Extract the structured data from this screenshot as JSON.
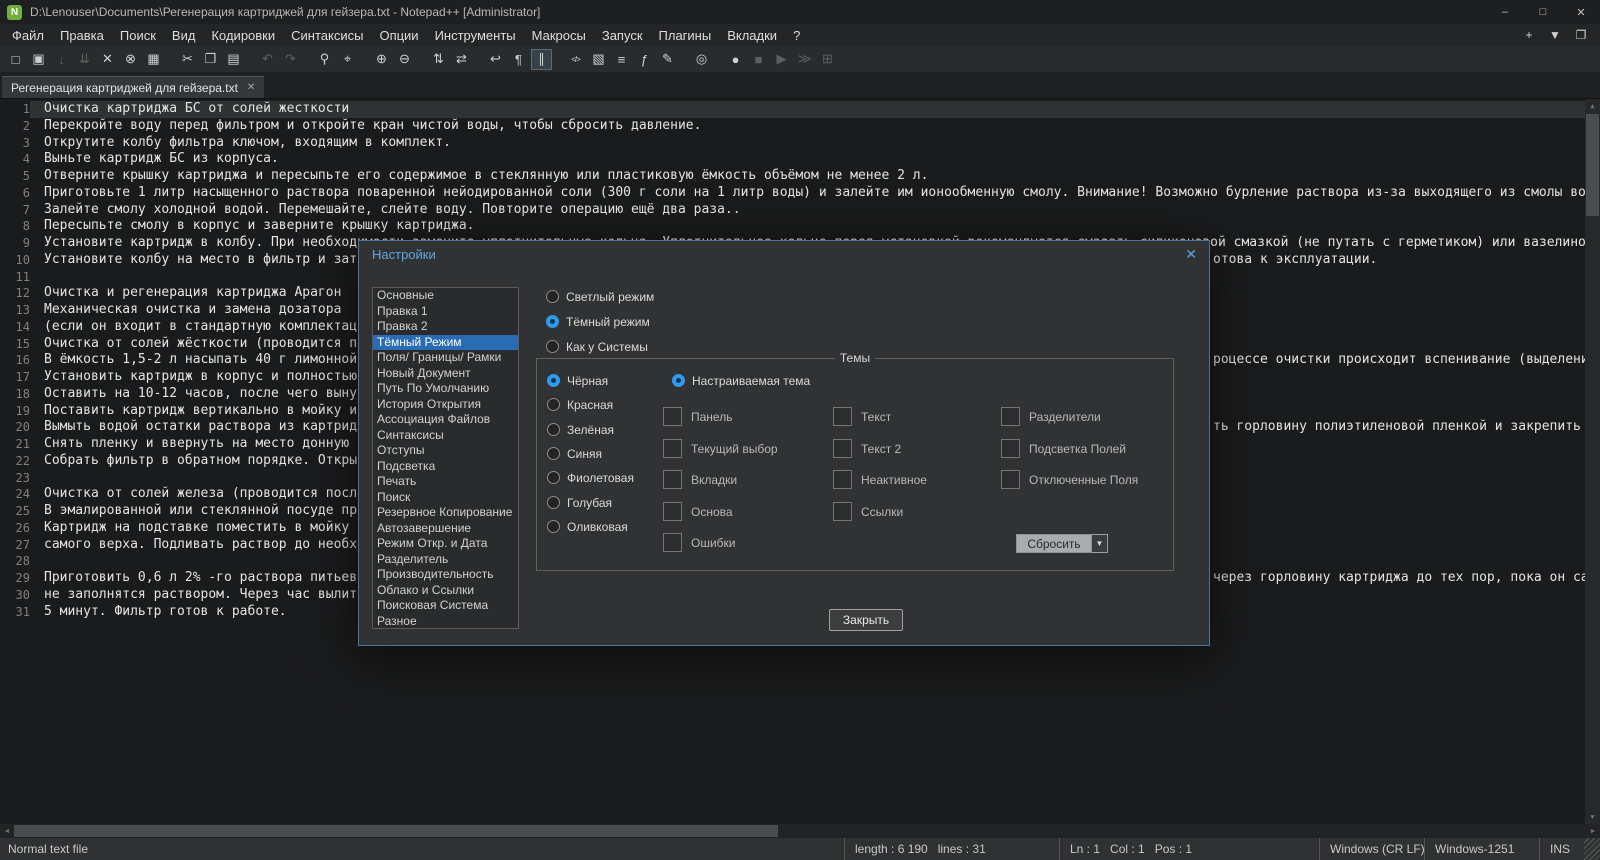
{
  "colors": {
    "accent_blue": "#2f9bed",
    "selected_item_bg": "#2a6cb4",
    "dialog_border": "#49759c",
    "current_line_bg": "#2f3334",
    "editor_bg": "#1a1b1c"
  },
  "window": {
    "title": "D:\\Lenouser\\Documents\\Регенерация картриджей для гейзера.txt - Notepad++ [Administrator]",
    "app_icon_letter": "N",
    "controls": [
      {
        "name": "minimize-button",
        "glyph": "–"
      },
      {
        "name": "maximize-button",
        "glyph": "□"
      },
      {
        "name": "close-button",
        "glyph": "✕"
      }
    ]
  },
  "menubar": {
    "items": [
      "Файл",
      "Правка",
      "Поиск",
      "Вид",
      "Кодировки",
      "Синтаксисы",
      "Опции",
      "Инструменты",
      "Макросы",
      "Запуск",
      "Плагины",
      "Вкладки",
      "?"
    ],
    "right_buttons": [
      {
        "name": "new-tab-button",
        "glyph": "+"
      },
      {
        "name": "tab-list-button",
        "glyph": "▼"
      },
      {
        "name": "windows-button",
        "glyph": "❐"
      }
    ]
  },
  "toolbar": {
    "icons": [
      {
        "name": "new-file-icon",
        "glyph": "□"
      },
      {
        "name": "open-folder-icon",
        "glyph": "▣"
      },
      {
        "name": "save-icon",
        "glyph": "↓",
        "disabled": true
      },
      {
        "name": "save-all-icon",
        "glyph": "⇊",
        "disabled": true
      },
      {
        "name": "close-file-icon",
        "glyph": "✕"
      },
      {
        "name": "close-all-icon",
        "glyph": "⊗"
      },
      {
        "name": "print-icon",
        "glyph": "▦"
      },
      {
        "name": "cut-icon",
        "glyph": "✂",
        "gap": true
      },
      {
        "name": "copy-icon",
        "glyph": "❐"
      },
      {
        "name": "paste-icon",
        "glyph": "▤"
      },
      {
        "name": "undo-icon",
        "glyph": "↶",
        "gap": true,
        "disabled": true
      },
      {
        "name": "redo-icon",
        "glyph": "↷",
        "disabled": true
      },
      {
        "name": "find-icon",
        "glyph": "⚲",
        "gap": true
      },
      {
        "name": "replace-icon",
        "glyph": "⌖"
      },
      {
        "name": "zoom-in-icon",
        "glyph": "⊕",
        "gap": true
      },
      {
        "name": "zoom-out-icon",
        "glyph": "⊖"
      },
      {
        "name": "sync-vertical-icon",
        "glyph": "⇅",
        "gap": true
      },
      {
        "name": "sync-horizontal-icon",
        "glyph": "⇄"
      },
      {
        "name": "word-wrap-icon",
        "glyph": "↩",
        "gap": true
      },
      {
        "name": "show-all-chars-icon",
        "glyph": "¶"
      },
      {
        "name": "indent-guide-icon",
        "glyph": "∥",
        "active": true
      },
      {
        "name": "code-view-icon",
        "glyph": "</>",
        "gap": true,
        "small": true
      },
      {
        "name": "document-map-icon",
        "glyph": "▧"
      },
      {
        "name": "document-list-icon",
        "glyph": "≡"
      },
      {
        "name": "function-list-icon",
        "glyph": "ƒ"
      },
      {
        "name": "edit-popup-icon",
        "glyph": "✎"
      },
      {
        "name": "monitoring-eye-icon",
        "glyph": "◎",
        "gap": true
      },
      {
        "name": "record-macro-icon",
        "glyph": "●",
        "gap": true
      },
      {
        "name": "stop-macro-icon",
        "glyph": "■",
        "disabled": true
      },
      {
        "name": "play-macro-icon",
        "glyph": "▶",
        "disabled": true
      },
      {
        "name": "run-macro-multiple-icon",
        "glyph": "≫",
        "disabled": true
      },
      {
        "name": "save-macro-icon",
        "glyph": "⊞",
        "disabled": true
      }
    ]
  },
  "tabbar": {
    "tabs": [
      {
        "label": "Регенерация картриджей для гейзера.txt",
        "close_glyph": "✕",
        "active": true
      }
    ]
  },
  "scrollbar": {
    "up": "▲",
    "down": "▼",
    "left": "◄",
    "right": "►"
  },
  "editor": {
    "lines": [
      {
        "n": 1,
        "current": true,
        "text": "Очистка картриджа БС от солей жесткости"
      },
      {
        "n": 2,
        "text": "Перекройте воду перед фильтром и откройте кран чистой воды, чтобы сбросить давление."
      },
      {
        "n": 3,
        "text": "Открутите колбу фильтра ключом, входящим в комплект."
      },
      {
        "n": 4,
        "text": "Выньте картридж БС из корпуса."
      },
      {
        "n": 5,
        "text": "Отверните крышку картриджа и пересыпьте его содержимое в стеклянную или пластиковую ёмкость объёмом не менее 2 л."
      },
      {
        "n": 6,
        "text": "Приготовьте 1 литр насыщенного раствора поваренной нейодированной соли (300 г соли на 1 литр воды) и залейте им ионообменную смолу. Внимание! Возможно бурление раствора из-за выходящего из смолы воздуха. Переме"
      },
      {
        "n": 7,
        "text": "Залейте смолу холодной водой. Перемешайте, слейте воду. Повторите операцию ещё два раза.."
      },
      {
        "n": 8,
        "text": "Пересыпьте смолу в корпус и заверните крышку картриджа."
      },
      {
        "n": 9,
        "text": "Установите картридж в колбу. При необходимости замените уплотнительные кольца. Уплотнительное кольцо перед установкой рекомендуется смазать силиконовой смазкой (не путать с герметиком) или вазелином."
      },
      {
        "n": 10,
        "text": "Установите колбу на место в фильтр и затян",
        "right": "отова к эксплуатации."
      },
      {
        "n": 11,
        "text": ""
      },
      {
        "n": 12,
        "text": "Очистка и регенерация картриджа Арагон"
      },
      {
        "n": 13,
        "text": "Механическая очистка и замена дозатора"
      },
      {
        "n": 14,
        "text": "(если он входит в стандартную комплектаци"
      },
      {
        "n": 15,
        "text": "Очистка от солей жёсткости (проводится пос"
      },
      {
        "n": 16,
        "text": "В ёмкость 1,5-2 л насыпать 40 г лимонной к",
        "right": "роцессе очистки происходит вспенивание (выделение"
      },
      {
        "n": 17,
        "text": "Установить картридж в корпус и полностью з"
      },
      {
        "n": 18,
        "text": "Оставить на 10-12 часов, после чего вынут"
      },
      {
        "n": 19,
        "text": "Поставить картридж вертикально в мойку и п"
      },
      {
        "n": 20,
        "text": "Вымыть водой остатки раствора из картриджа",
        "right": "ть горловину полиэтиленовой пленкой и закрепить ее"
      },
      {
        "n": 21,
        "text": "Снять пленку и ввернуть на место донную за"
      },
      {
        "n": 22,
        "text": "Собрать фильтр в обратном порядке. Откры"
      },
      {
        "n": 23,
        "text": ""
      },
      {
        "n": 24,
        "text": "Очистка от солей железа (проводится после"
      },
      {
        "n": 25,
        "text": "В эмалированной или стеклянной посуде приг"
      },
      {
        "n": 26,
        "text": "Картридж на подставке поместить в мойку и"
      },
      {
        "n": 27,
        "text": "самого верха. Подливать раствор до необх"
      },
      {
        "n": 28,
        "text": ""
      },
      {
        "n": 29,
        "text": "Приготовить 0,6 л 2% -го раствора питьевой",
        "right": "через горловину картриджа до тех пор, пока он са"
      },
      {
        "n": 30,
        "text": "не заполнятся раствором. Через час вылить"
      },
      {
        "n": 31,
        "text": "5 минут. Фильтр готов к работе."
      }
    ]
  },
  "dialog": {
    "title": "Настройки",
    "close_glyph": "✕",
    "categories": [
      "Основные",
      "Правка 1",
      "Правка 2",
      "Тёмный Режим",
      "Поля/ Границы/ Рамки",
      "Новый Документ",
      "Путь По Умолчанию",
      "История Открытия",
      "Ассоциация Файлов",
      "Синтаксисы",
      "Отступы",
      "Подсветка",
      "Печать",
      "Поиск",
      "Резервное Копирование",
      "Автозавершение",
      "Режим Откр. и Дата",
      "Разделитель",
      "Производительность",
      "Облако и Ссылки",
      "Поисковая Система",
      "Разное"
    ],
    "selected_category": "Тёмный Режим",
    "mode_options": [
      {
        "label": "Светлый режим",
        "selected": false
      },
      {
        "label": "Тёмный режим",
        "selected": true
      },
      {
        "label": "Как у Системы",
        "selected": false
      }
    ],
    "themes_group": {
      "title": "Темы",
      "tones": [
        {
          "label": "Чёрная",
          "selected": true
        },
        {
          "label": "Красная",
          "selected": false
        },
        {
          "label": "Зелёная",
          "selected": false
        },
        {
          "label": "Синяя",
          "selected": false
        },
        {
          "label": "Фиолетовая",
          "selected": false
        },
        {
          "label": "Голубая",
          "selected": false
        },
        {
          "label": "Оливковая",
          "selected": false
        }
      ],
      "custom": {
        "label": "Настраиваемая тема",
        "selected": true
      },
      "swatches_col1": [
        "Панель",
        "Текущий выбор",
        "Вкладки",
        "Основа",
        "Ошибки"
      ],
      "swatches_col2": [
        "Текст",
        "Текст 2",
        "Неактивное",
        "Ссылки"
      ],
      "swatches_col3": [
        "Разделители",
        "Подсветка Полей",
        "Отключенные Поля"
      ],
      "reset_button": "Сбросить",
      "reset_dropdown_glyph": "▼"
    },
    "close_button": "Закрыть"
  },
  "statusbar": {
    "doc_type": "Normal text file",
    "length_info": "length : 6 190   lines : 31",
    "caret_info": "Ln : 1   Col : 1   Pos : 1",
    "eol": "Windows (CR LF)",
    "encoding": "Windows-1251",
    "mode": "INS"
  }
}
